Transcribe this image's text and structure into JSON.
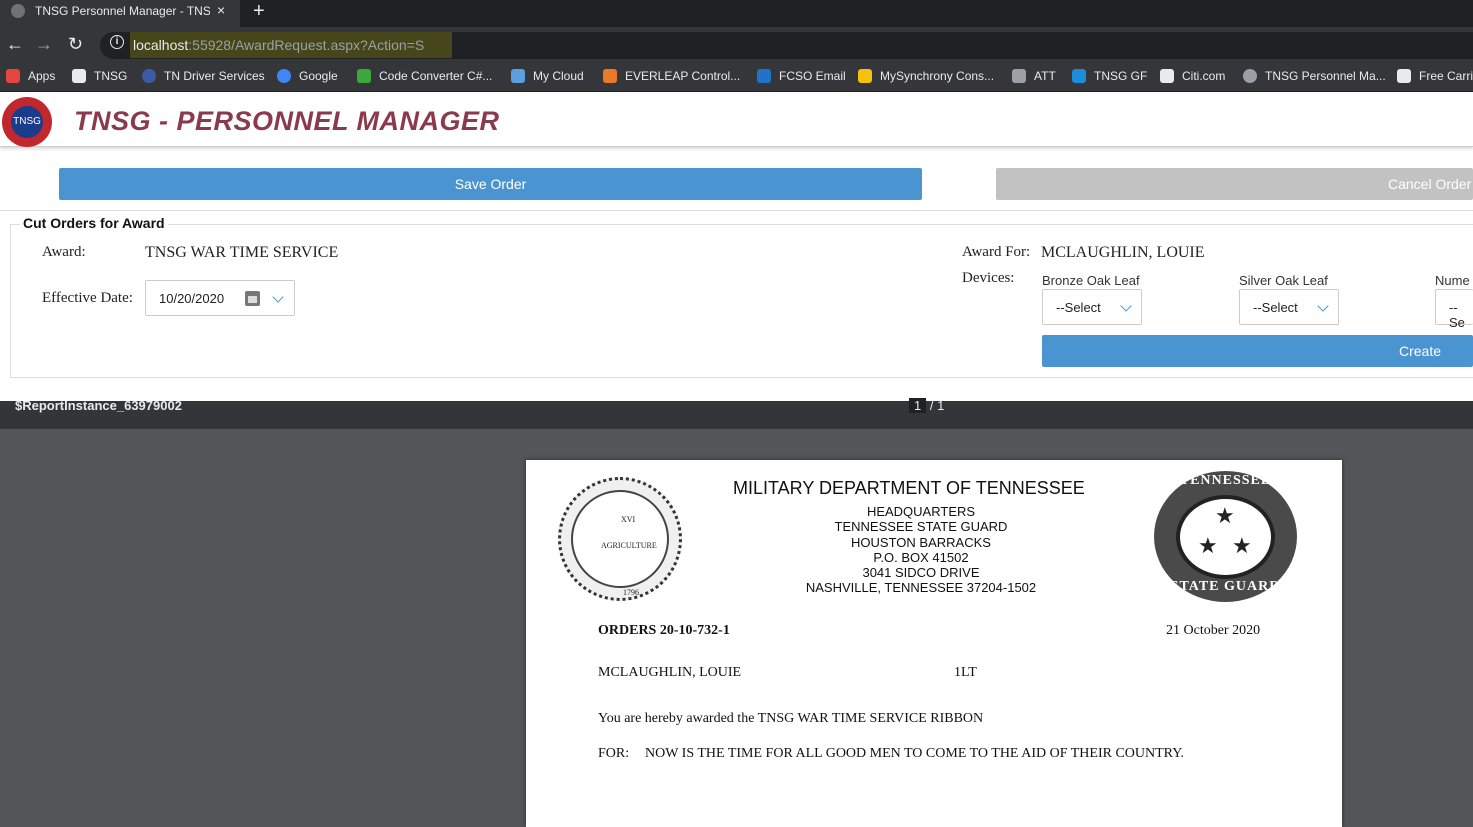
{
  "browser": {
    "tab_title": "TNSG Personnel Manager - TNSG",
    "close_glyph": "×",
    "new_tab_glyph": "+",
    "back_glyph": "←",
    "forward_glyph": "→",
    "reload_glyph": "↻",
    "url_host": "localhost",
    "url_rest": ":55928/AwardRequest.aspx?Action=S",
    "bookmarks": [
      {
        "label": "Apps",
        "color": "#e8453c"
      },
      {
        "label": "TNSG",
        "color": "#e8eaed"
      },
      {
        "label": "TN Driver Services",
        "color": "#3b5ba5"
      },
      {
        "label": "Google",
        "color": "#4285f4"
      },
      {
        "label": "Code Converter C#...",
        "color": "#3aa83a"
      },
      {
        "label": "My Cloud",
        "color": "#5aa0e0"
      },
      {
        "label": "EVERLEAP Control...",
        "color": "#e87a2a"
      },
      {
        "label": "FCSO Email",
        "color": "#1e73c9"
      },
      {
        "label": "MySynchrony Cons...",
        "color": "#f4c20d"
      },
      {
        "label": "ATT",
        "color": "#9aa0a6"
      },
      {
        "label": "TNSG GF",
        "color": "#1a8cd8"
      },
      {
        "label": "Citi.com",
        "color": "#e8eaed"
      },
      {
        "label": "TNSG Personnel Ma...",
        "color": "#9aa0a6"
      },
      {
        "label": "Free Carri",
        "color": "#e8eaed"
      }
    ]
  },
  "app": {
    "logo_text": "TNSG",
    "title": "TNSG - PERSONNEL MANAGER",
    "save_label": "Save Order",
    "cancel_label": "Cancel Order",
    "legend": "Cut Orders for Award",
    "award_label": "Award:",
    "award_value": "TNSG WAR TIME SERVICE",
    "effective_label": "Effective Date:",
    "effective_value": "10/20/2020",
    "award_for_label": "Award For:",
    "award_for_value": "MCLAUGHLIN, LOUIE",
    "devices_label": "Devices:",
    "bronze_label": "Bronze Oak Leaf",
    "bronze_value": "--Select",
    "silver_label": "Silver Oak Leaf",
    "silver_value": "--Select",
    "numeral_label": "Nume",
    "numeral_value": "--Se",
    "create_label": "Create Orde"
  },
  "viewer": {
    "title": "$ReportInstance_63979002",
    "page_current": "1",
    "page_total": "/ 1"
  },
  "report": {
    "title": "MILITARY DEPARTMENT OF TENNESSEE",
    "address": [
      "HEADQUARTERS",
      "TENNESSEE STATE GUARD",
      "HOUSTON BARRACKS",
      "P.O. BOX 41502",
      "3041 SIDCO DRIVE",
      "NASHVILLE, TENNESSEE 37204-1502"
    ],
    "orders": "ORDERS 20-10-732-1",
    "date": "21 October 2020",
    "name": "MCLAUGHLIN, LOUIE",
    "rank": "1LT",
    "award_text": "You are hereby awarded the TNSG WAR TIME SERVICE RIBBON",
    "for_label": "FOR:",
    "for_text": "NOW IS THE TIME FOR ALL GOOD MEN TO COME TO THE AID OF THEIR COUNTRY.",
    "seal_left": {
      "top": "THE GREAT SEAL OF THE STATE",
      "mid": "AGRICULTURE",
      "year": "1796"
    },
    "seal_right": {
      "top": "TENNESSEE",
      "bottom": "STATE GUARD",
      "star": "★"
    }
  }
}
